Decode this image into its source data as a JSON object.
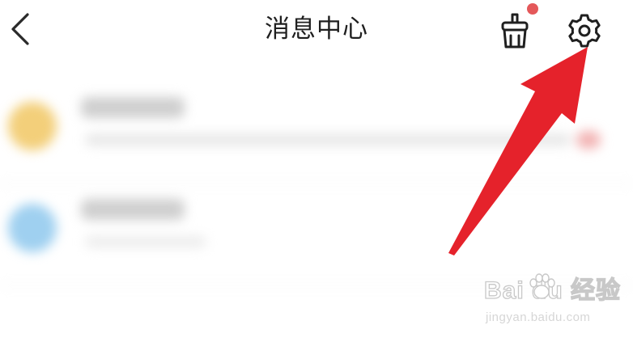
{
  "header": {
    "title": "消息中心",
    "back_icon": "chevron-left-icon",
    "clean_icon": "broom-icon",
    "settings_icon": "gear-icon",
    "has_notification_dot": true
  },
  "colors": {
    "notification_dot": "#e4585a",
    "annotation_arrow": "#e5222b",
    "title_text": "#1f1f1f"
  },
  "watermark": {
    "logo_text": "Bai du 经验",
    "url": "jingyan.baidu.com"
  }
}
